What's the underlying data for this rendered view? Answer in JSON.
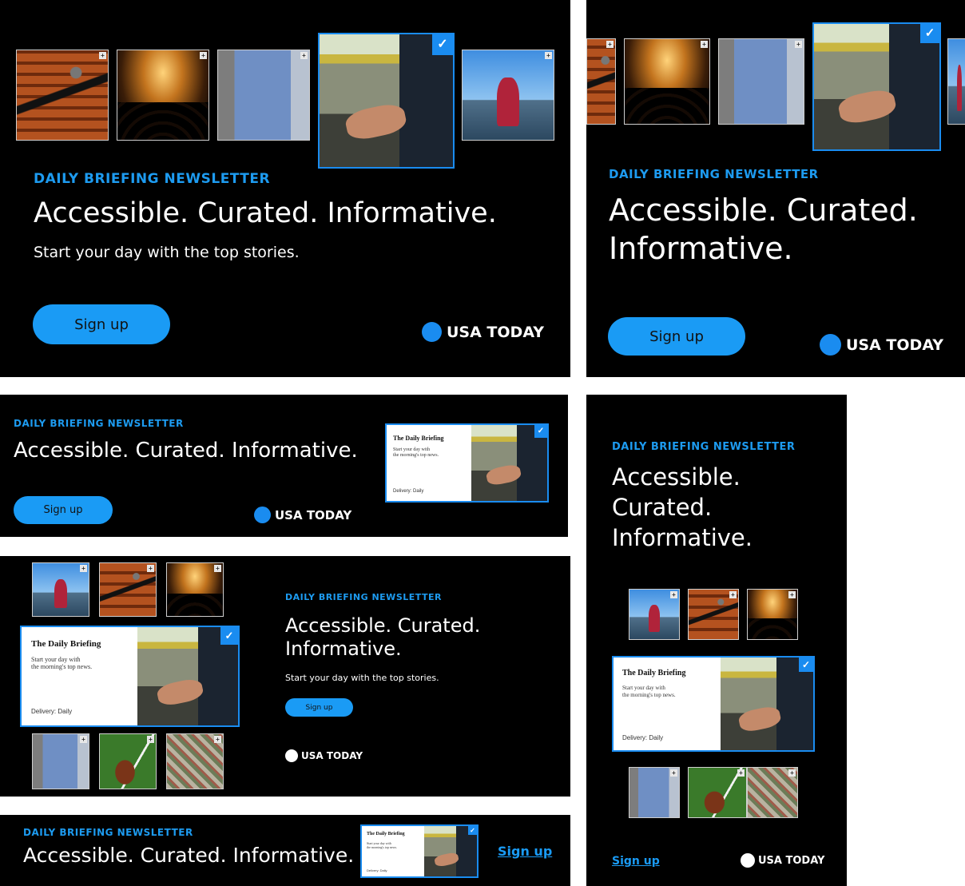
{
  "newsletter": {
    "eyebrow": "DAILY BRIEFING NEWSLETTER",
    "headline": "Accessible. Curated. Informative.",
    "headline_lines": [
      "Accessible.",
      "Curated.",
      "Informative."
    ],
    "headline_two_lines_a": [
      "Accessible. Curated.",
      "Informative."
    ],
    "subhead": "Start your day with the top stories.",
    "signup_label": "Sign up",
    "brand": "USA TODAY"
  },
  "card": {
    "title": "The Daily Briefing",
    "subtitle_lines": [
      "Start your day with",
      "the morning's top news."
    ],
    "delivery": "Delivery: Daily"
  },
  "icons": {
    "check": "✓",
    "plus": "+"
  },
  "colors": {
    "background": "#000000",
    "accent": "#1a9bf5",
    "text": "#ffffff",
    "logo_dot_blue": "#1a8cf0",
    "logo_dot_white": "#ffffff"
  }
}
